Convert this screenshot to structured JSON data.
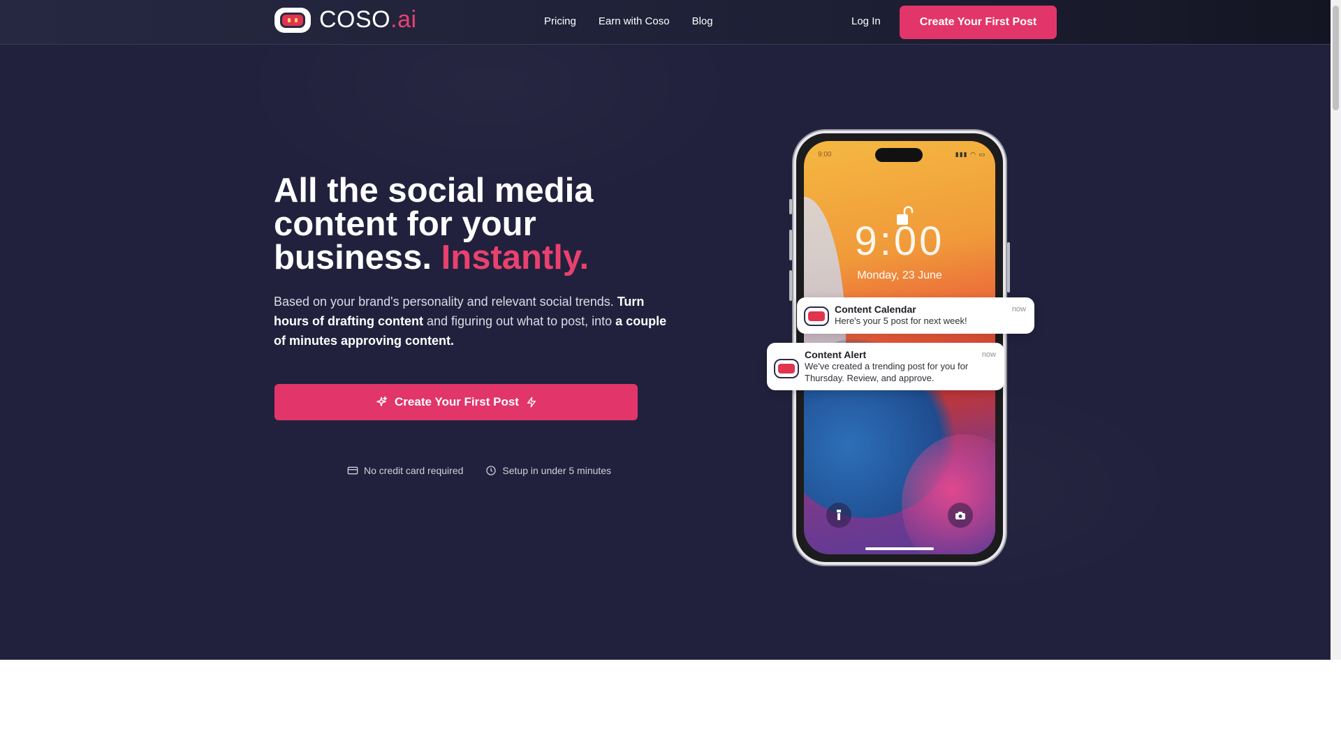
{
  "nav": {
    "logo_text": "COSO",
    "logo_suffix": ".ai",
    "links": [
      "Pricing",
      "Earn with Coso",
      "Blog"
    ],
    "login": "Log In",
    "cta": "Create Your First Post"
  },
  "hero": {
    "headline_line1": "All the social media",
    "headline_line2": "content for your",
    "headline_line3": "business.",
    "headline_accent": "Instantly.",
    "sub_1": "Based on your brand's personality and relevant social trends. ",
    "sub_2": "Turn hours of drafting content",
    "sub_3": " and figuring out what to post, into ",
    "sub_4": "a couple of minutes approving content.",
    "cta": "Create Your First Post",
    "perks": [
      "No credit card required",
      "Setup in under 5 minutes"
    ]
  },
  "phone": {
    "status_time": "9:00",
    "lock_time": "9:00",
    "lock_date": "Monday,  23 June",
    "notifications": [
      {
        "title": "Content Calendar",
        "body": "Here's your 5 post for next week!",
        "time": "now"
      },
      {
        "title": "Content Alert",
        "body": "We've created a trending post for you for Thursday. Review, and approve.",
        "time": "now"
      }
    ]
  },
  "colors": {
    "accent": "#e2356a",
    "background": "#22213d"
  }
}
